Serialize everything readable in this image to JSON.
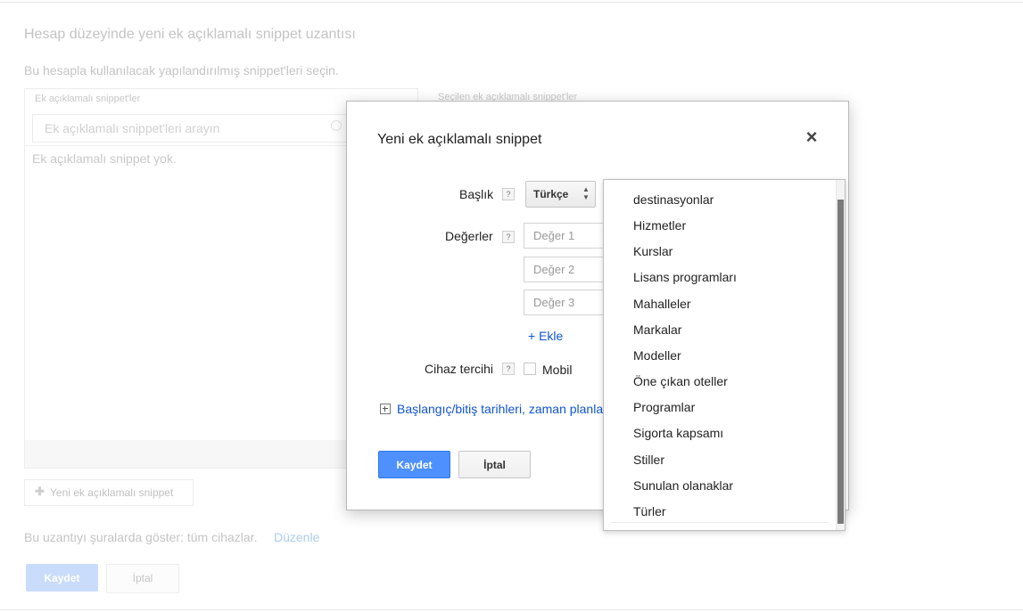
{
  "background": {
    "title": "Hesap düzeyinde yeni ek açıklamalı snippet uzantısı",
    "subtitle": "Bu hesapla kullanılacak yapılandırılmış snippet'leri seçin.",
    "panel_label": "Ek açıklamalı snippet'ler",
    "search_placeholder": "Ek açıklamalı snippet'leri arayın",
    "empty_text": "Ek açıklamalı snippet yok.",
    "right_label": "Seçilen ek açıklamalı snippet'ler",
    "new_button": "Yeni ek açıklamalı snippet",
    "show_text": "Bu uzantıyı şuralarda göster: tüm cihazlar.",
    "edit_link": "Düzenle",
    "save": "Kaydet",
    "cancel": "İptal"
  },
  "modal": {
    "title": "Yeni ek açıklamalı snippet",
    "close_symbol": "×",
    "heading_label": "Başlık",
    "values_label": "Değerler",
    "device_label": "Cihaz tercihi",
    "help_symbol": "?",
    "language": "Türkçe",
    "value_placeholders": [
      "Değer 1",
      "Değer 2",
      "Değer 3"
    ],
    "add_link": "+ Ekle",
    "mobile_label": "Mobil",
    "expand_link": "Başlangıç/bitiş tarihleri, zaman planlama",
    "save": "Kaydet",
    "cancel": "İptal"
  },
  "dropdown": {
    "items": [
      "destinasyonlar",
      "Hizmetler",
      "Kurslar",
      "Lisans programları",
      "Mahalleler",
      "Markalar",
      "Modeller",
      "Öne çıkan oteller",
      "Programlar",
      "Sigorta kapsamı",
      "Stiller",
      "Sunulan olanaklar",
      "Türler"
    ]
  }
}
